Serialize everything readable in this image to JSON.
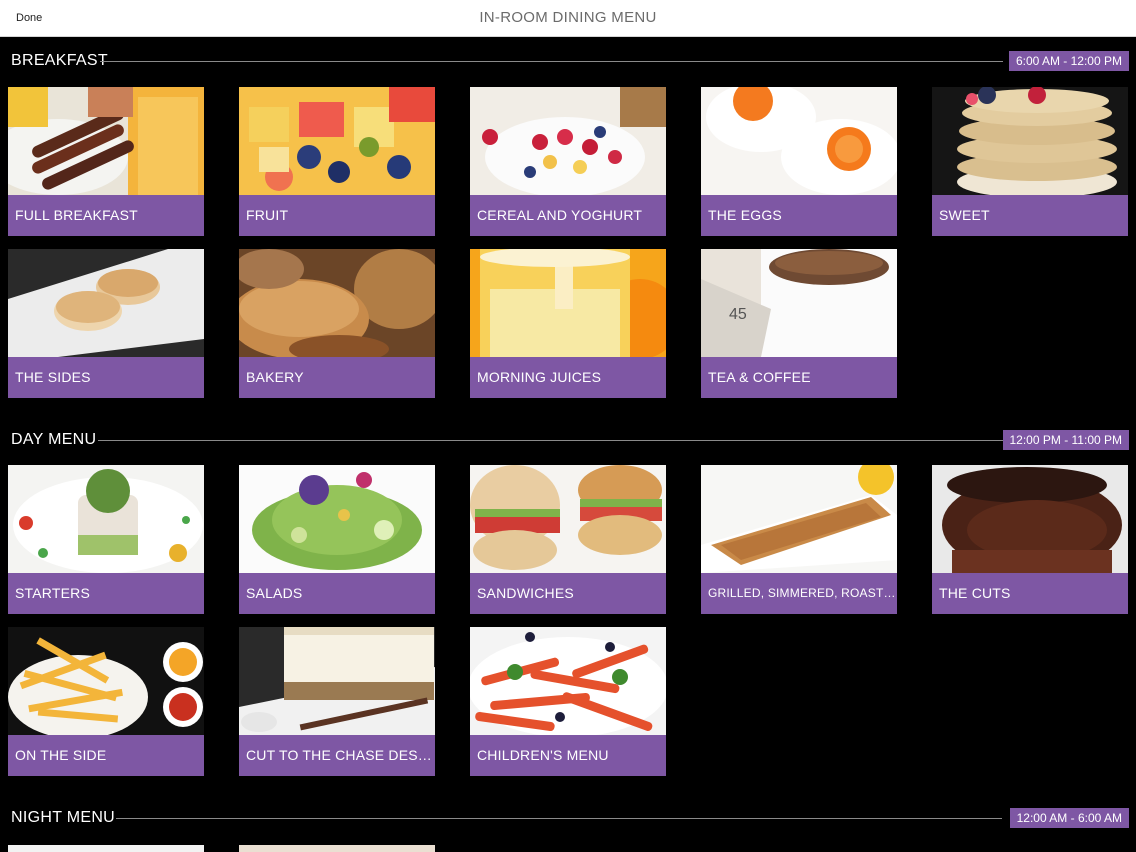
{
  "topbar": {
    "done_label": "Done",
    "title": "IN-ROOM DINING MENU"
  },
  "sections": [
    {
      "title": "BREAKFAST",
      "hours": "6:00 AM - 12:00 PM",
      "items": [
        {
          "label": "FULL BREAKFAST",
          "photo": "full-breakfast-photo"
        },
        {
          "label": "FRUIT",
          "photo": "fruit-photo"
        },
        {
          "label": "CEREAL AND YOGHURT",
          "photo": "cereal-yoghurt-photo"
        },
        {
          "label": "THE EGGS",
          "photo": "eggs-photo"
        },
        {
          "label": "SWEET",
          "photo": "pancakes-photo"
        },
        {
          "label": "THE SIDES",
          "photo": "sides-photo"
        },
        {
          "label": "BAKERY",
          "photo": "bakery-photo"
        },
        {
          "label": "MORNING JUICES",
          "photo": "juices-photo"
        },
        {
          "label": "TEA & COFFEE",
          "photo": "coffee-photo"
        }
      ]
    },
    {
      "title": "DAY MENU",
      "hours": "12:00 PM - 11:00 PM",
      "items": [
        {
          "label": "STARTERS",
          "photo": "starters-photo"
        },
        {
          "label": "SALADS",
          "photo": "salads-photo"
        },
        {
          "label": "SANDWICHES",
          "photo": "sandwiches-photo"
        },
        {
          "label": "GRILLED, SIMMERED, ROASTED OR...",
          "photo": "grilled-photo"
        },
        {
          "label": "THE CUTS",
          "photo": "steak-photo"
        },
        {
          "label": "ON THE SIDE",
          "photo": "fries-photo"
        },
        {
          "label": "CUT TO THE CHASE DESSERT",
          "photo": "dessert-photo"
        },
        {
          "label": "CHILDREN'S MENU",
          "photo": "pasta-photo"
        }
      ]
    },
    {
      "title": "NIGHT MENU",
      "hours": "12:00 AM - 6:00 AM",
      "items": []
    }
  ],
  "colors": {
    "accent": "#7e57a4",
    "background": "#000000",
    "topbar": "#ffffff"
  }
}
